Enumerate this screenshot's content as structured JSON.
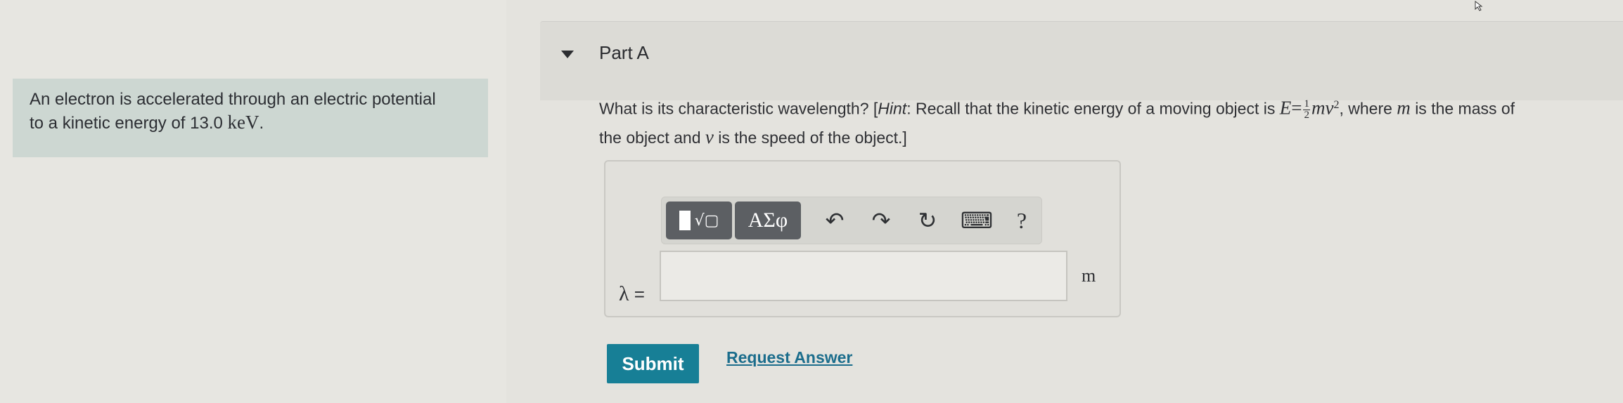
{
  "problem": {
    "text_line1": "An electron is accelerated through an electric potential",
    "text_line2": "to a kinetic energy of 13.0",
    "unit": "keV",
    "end": "."
  },
  "part": {
    "title": "Part A",
    "question_prefix": "What is its characteristic wavelength? [",
    "hint_label": "Hint",
    "hint_text": ": Recall that the kinetic energy of a moving object is",
    "where_text": ", where",
    "mass_text": "is the mass of",
    "line2_prefix": "the object and",
    "speed_text": "is the speed of the object.]"
  },
  "math": {
    "E": "E",
    "eq": "=",
    "num": "1",
    "den": "2",
    "mv": "mv",
    "exp": "2",
    "m": "m",
    "v": "v"
  },
  "toolbar": {
    "symbols_label": "ΑΣφ",
    "templates_glyph": "√",
    "templates_box": "▢",
    "undo_glyph": "↶",
    "redo_glyph": "↷",
    "reset_glyph": "↻",
    "keyboard_glyph": "⌨",
    "help_glyph": "?"
  },
  "answer": {
    "variable": "λ",
    "equals": "=",
    "value": "",
    "unit": "m"
  },
  "actions": {
    "submit_label": "Submit",
    "request_label": "Request Answer"
  },
  "colors": {
    "submit": "#177f96",
    "link": "#1b6d8c",
    "problem_bg": "#cdd7d2"
  }
}
